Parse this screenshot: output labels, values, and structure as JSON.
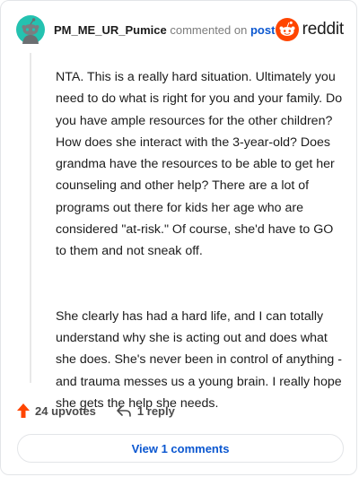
{
  "comment": {
    "username": "PM_ME_UR_Pumice",
    "action_text": "commented on",
    "post_link": "post",
    "paragraphs": [
      "NTA. This is a really hard situation. Ultimately you need to do what is right for you and your family. Do you have ample resources for the other children? How does she interact with the 3-year-old? Does grandma have the resources to be able to get her counseling and other help? There are a lot of programs out there for kids her age who are considered \"at-risk.\" Of course, she'd have to GO to them and not sneak off.",
      "She clearly has had a hard life, and I can totally understand why she is acting out and does what she does. She's never been in control of anything - and trauma messes us a young brain. I really hope she gets the help she needs."
    ],
    "upvotes_label": "24 upvotes",
    "replies_label": "1 reply",
    "view_comments_label": "View 1 comments"
  },
  "brand": {
    "name": "reddit",
    "accent": "#ff4500"
  },
  "icons": {
    "avatar": "snoo-avatar-icon",
    "logo": "reddit-logo-icon",
    "upvote": "upvote-arrow-icon",
    "reply": "reply-arrow-icon"
  },
  "colors": {
    "avatar_bg": "#24c2b0",
    "upvote": "#ff4500",
    "link": "#0b57d0"
  }
}
